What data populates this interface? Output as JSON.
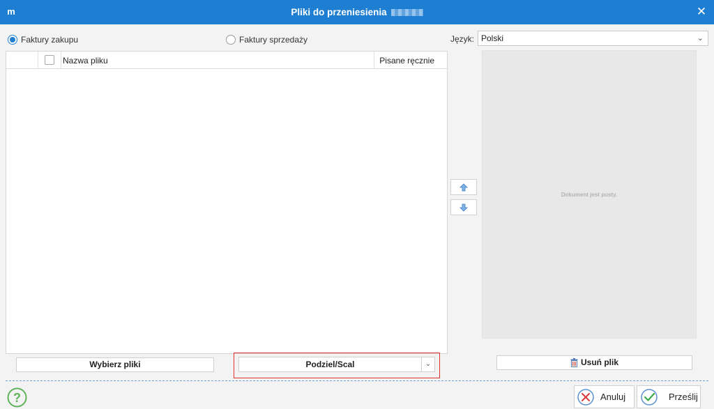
{
  "window": {
    "title": "Pliki do przeniesienia",
    "logo_icon": "app-logo-icon",
    "close_icon": "close-icon"
  },
  "invoice_type": {
    "options": [
      {
        "label": "Faktury zakupu",
        "selected": true
      },
      {
        "label": "Faktury sprzedaży",
        "selected": false
      }
    ]
  },
  "language": {
    "label": "Język:",
    "value": "Polski"
  },
  "table": {
    "columns": [
      "",
      "",
      "Nazwa pliku",
      "Pisane ręcznie"
    ],
    "rows": []
  },
  "preview": {
    "empty_text": "Dokument jest pusty."
  },
  "buttons": {
    "choose_files": "Wybierz pliki",
    "split_merge": "Podziel/Scal",
    "remove_file": "Usuń plik",
    "cancel": "Anuluj",
    "send": "Prześlij"
  },
  "colors": {
    "accent": "#1e7fd2",
    "highlight_border": "#e0312f",
    "cancel_icon": "#d93a3a",
    "send_icon": "#3aa845",
    "help_icon": "#5fb35a"
  }
}
